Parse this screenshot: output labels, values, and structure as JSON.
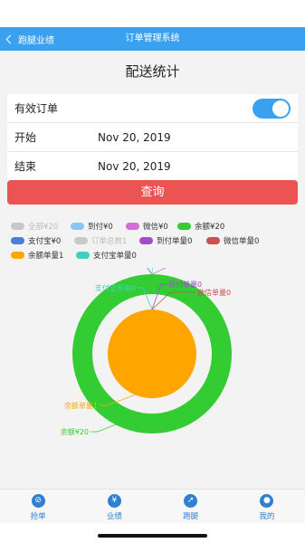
{
  "header": {
    "back_label": "跑腿业绩",
    "title": "订单管理系统"
  },
  "page": {
    "title": "配送统计"
  },
  "filters": {
    "valid_label": "有效订单",
    "valid_on": true,
    "start_label": "开始",
    "start_value": "Nov 20, 2019",
    "end_label": "结束",
    "end_value": "Nov 20, 2019"
  },
  "query_button": "查询",
  "legend": [
    {
      "label": "全部¥20",
      "color": "#c8c8c8",
      "enabled": false
    },
    {
      "label": "到付¥0",
      "color": "#87c8f0",
      "enabled": true
    },
    {
      "label": "微信¥0",
      "color": "#d36fd3",
      "enabled": true
    },
    {
      "label": "余额¥20",
      "color": "#33cc33",
      "enabled": true
    },
    {
      "label": "支付宝¥0",
      "color": "#4a7fd8",
      "enabled": true
    },
    {
      "label": "订单总数1",
      "color": "#c8c8c8",
      "enabled": false
    },
    {
      "label": "到付单量0",
      "color": "#a24ad0",
      "enabled": true
    },
    {
      "label": "微信单量0",
      "color": "#c85050",
      "enabled": true
    },
    {
      "label": "余额单量1",
      "color": "#ffa500",
      "enabled": true
    },
    {
      "label": "支付宝单量0",
      "color": "#3fd0c0",
      "enabled": true
    }
  ],
  "chart_data": {
    "type": "pie",
    "outer_ring": [
      {
        "name": "支付宝",
        "label": "支付宝¥0",
        "value": 0,
        "color": "#4a7fd8"
      },
      {
        "name": "到付",
        "label": "到付¥0",
        "value": 0,
        "color": "#87c8f0"
      },
      {
        "name": "微信",
        "label": "微信¥0",
        "value": 0,
        "color": "#d36fd3"
      },
      {
        "name": "余额",
        "label": "余额¥20",
        "value": 20,
        "color": "#33cc33"
      }
    ],
    "inner_pie": [
      {
        "name": "支付宝单量",
        "label": "支付宝单量0",
        "value": 0,
        "color": "#3fd0c0"
      },
      {
        "name": "到付单量",
        "label": "到付单量0",
        "value": 0,
        "color": "#a24ad0"
      },
      {
        "name": "微信单量",
        "label": "微信单量0",
        "value": 0,
        "color": "#c85050"
      },
      {
        "name": "余额单量",
        "label": "余额单量1",
        "value": 1,
        "color": "#ffa500"
      }
    ]
  },
  "tabs": [
    {
      "label": "抢单",
      "icon": "grab-order-icon",
      "glyph": "⊘"
    },
    {
      "label": "业绩",
      "icon": "performance-icon",
      "glyph": "¥"
    },
    {
      "label": "跑腿",
      "icon": "compass-icon",
      "glyph": "➚"
    },
    {
      "label": "我的",
      "icon": "user-icon",
      "glyph": "●"
    }
  ],
  "colors": {
    "accent": "#3aa0f0",
    "query": "#ec5353",
    "tab": "#2f7fd3"
  }
}
